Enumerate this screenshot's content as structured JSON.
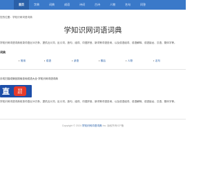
{
  "nav": {
    "items": [
      {
        "label": "首页",
        "active": true
      },
      {
        "label": "字典"
      },
      {
        "label": "词典"
      },
      {
        "label": "成语"
      },
      {
        "label": "诗词"
      },
      {
        "label": "古诗"
      },
      {
        "label": "人物"
      },
      {
        "label": "名句"
      },
      {
        "label": "问答"
      }
    ]
  },
  "breadcrumb": "您的位置：学知识网词语词典",
  "site_title": "学知识网词语词典",
  "intro": "学知识网词语词典收录词语近30万条，提供近义词、反义词、造句、组词、词语拼音、新词等词语查询，以及成语组词、成语解释、成语接龙、汉语、繁体字等。",
  "section_head": "词典",
  "categories": [
    "常用",
    "成语",
    "谚语",
    "歇后",
    "人物",
    "名句"
  ],
  "app_promo": "手机扫描或微信搜索查询成语大全·学知识网词语词典",
  "logo": {
    "zhi": "直",
    "badge_line1": "宝宝",
    "badge_line2": "起名"
  },
  "app_desc": "学知识网词语词典收录词语近30万条，提供近义词、反义词、造句、组词、词语拼音、新词等词语查询，以及成语组词、成语解释、成语接龙、汉语、繁体字等。",
  "footer": {
    "prefix": "Copyright © 2024 ",
    "link": "学知识网词语词典",
    "suffix": " Inc. 版权所有ICP备"
  },
  "colors": {
    "nav_bg": "#3a79c9",
    "link": "#2a60a8",
    "logo_bg": "#1d4ea8",
    "badge_bg": "#e7392a"
  }
}
